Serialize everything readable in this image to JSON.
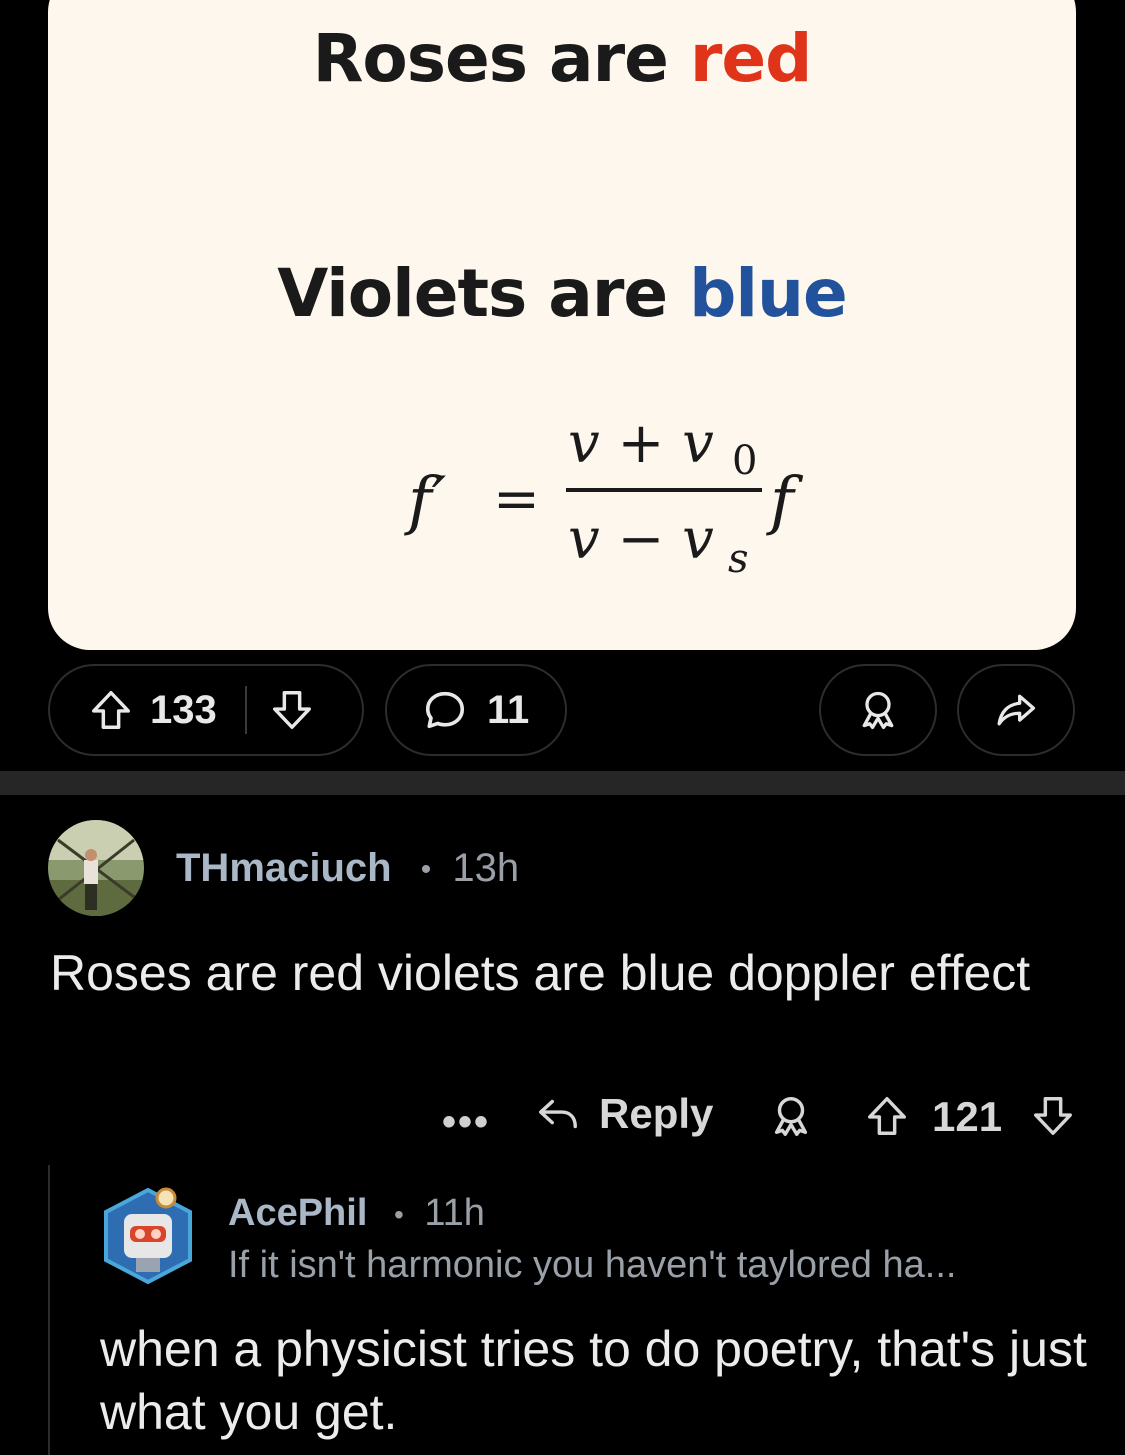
{
  "post": {
    "image": {
      "line1_prefix": "Roses are ",
      "line1_color_word": "red",
      "line2_prefix": "Violets are ",
      "line2_color_word": "blue",
      "formula": {
        "lhs": "f′",
        "equals": "=",
        "numerator": "v + v",
        "numerator_sub": "0",
        "denominator": "v − v",
        "denominator_sub": "s",
        "rhs": "f"
      },
      "colors": {
        "red": "#e0341a",
        "blue": "#22529b",
        "background": "#fdf7ee"
      }
    },
    "actions": {
      "upvote_icon": "arrow-up-icon",
      "score": "133",
      "downvote_icon": "arrow-down-icon",
      "comment_icon": "speech-bubble-icon",
      "comment_count": "11",
      "award_icon": "award-icon",
      "share_icon": "share-icon"
    }
  },
  "comments": [
    {
      "username": "THmaciuch",
      "separator": "•",
      "time": "13h",
      "body": "Roses are red violets are blue doppler effect",
      "actions": {
        "more": "•••",
        "reply_label": "Reply",
        "score": "121"
      },
      "replies": [
        {
          "username": "AcePhil",
          "separator": "•",
          "time": "11h",
          "flair": "If it isn't harmonic you haven't taylored ha...",
          "body": "when a physicist tries to do poetry, that's just what you get."
        }
      ]
    }
  ]
}
